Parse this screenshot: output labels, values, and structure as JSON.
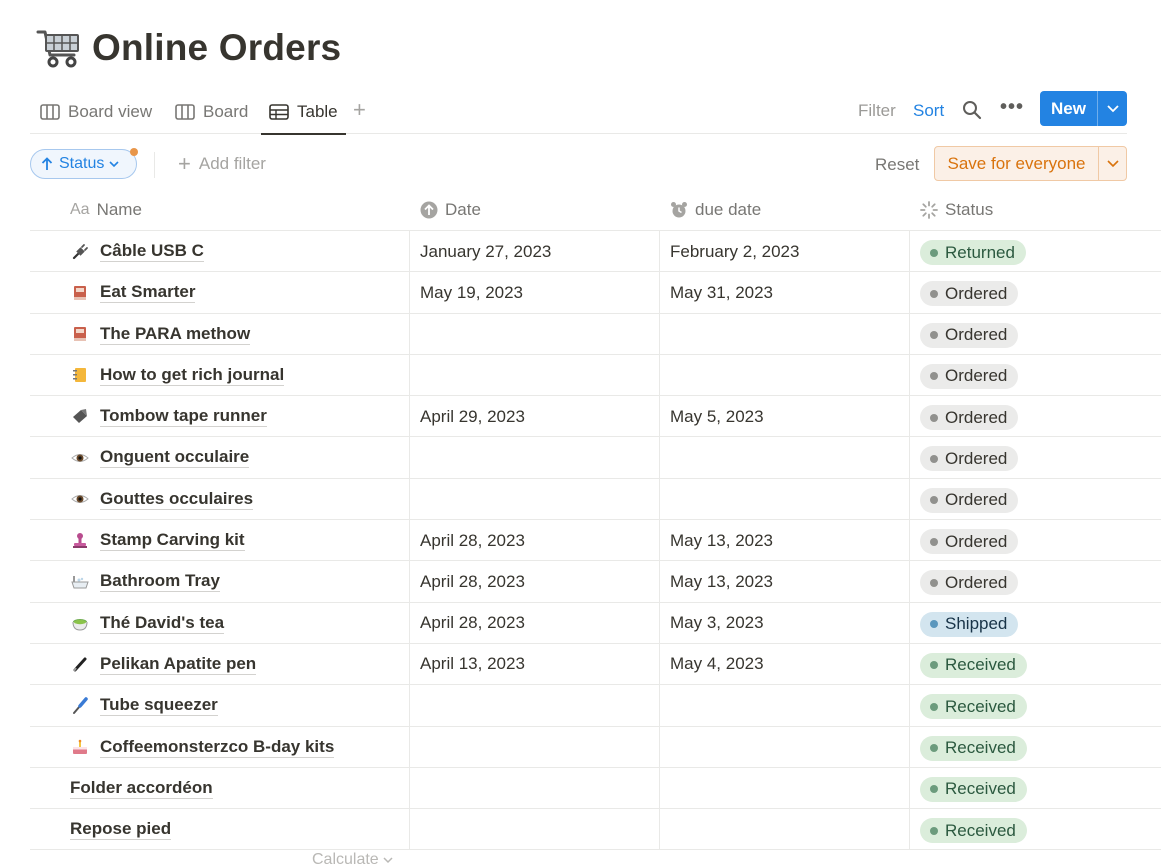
{
  "page": {
    "title": "Online Orders",
    "title_icon": "shopping-cart-icon"
  },
  "views": {
    "tabs": [
      {
        "label": "Board view",
        "icon": "board-icon"
      },
      {
        "label": "Board",
        "icon": "board-icon"
      },
      {
        "label": "Table",
        "icon": "table-icon",
        "active": true
      }
    ],
    "add_view": "+",
    "filter_label": "Filter",
    "sort_label": "Sort",
    "more": "•••",
    "new_label": "New"
  },
  "filters": {
    "status_chip": "Status",
    "add_filter": "Add filter",
    "reset": "Reset",
    "save": "Save for everyone"
  },
  "table": {
    "columns": {
      "name": "Name",
      "name_prefix": "Aa",
      "date": "Date",
      "due": "due date",
      "status": "Status"
    },
    "rows": [
      {
        "icon": "plug-icon",
        "name": "Câble USB C",
        "date": "January 27, 2023",
        "due": "February 2, 2023",
        "status": "Returned"
      },
      {
        "icon": "book-icon",
        "name": "Eat Smarter",
        "date": "May 19, 2023",
        "due": "May 31, 2023",
        "status": "Ordered"
      },
      {
        "icon": "book-icon",
        "name": "The PARA methow",
        "date": "",
        "due": "",
        "status": "Ordered"
      },
      {
        "icon": "notebook-icon",
        "name": "How to get rich journal",
        "date": "",
        "due": "",
        "status": "Ordered"
      },
      {
        "icon": "tape-icon",
        "name": "Tombow tape runner",
        "date": "April 29, 2023",
        "due": "May 5, 2023",
        "status": "Ordered"
      },
      {
        "icon": "eye-icon",
        "name": "Onguent occulaire",
        "date": "",
        "due": "",
        "status": "Ordered"
      },
      {
        "icon": "eye-icon",
        "name": "Gouttes occulaires",
        "date": "",
        "due": "",
        "status": "Ordered"
      },
      {
        "icon": "stamp-icon",
        "name": "Stamp Carving kit",
        "date": "April 28, 2023",
        "due": "May 13, 2023",
        "status": "Ordered"
      },
      {
        "icon": "bathtub-icon",
        "name": "Bathroom Tray",
        "date": "April 28, 2023",
        "due": "May 13, 2023",
        "status": "Ordered"
      },
      {
        "icon": "tea-icon",
        "name": "Thé David's tea",
        "date": "April 28, 2023",
        "due": "May 3, 2023",
        "status": "Shipped"
      },
      {
        "icon": "pen-icon",
        "name": "Pelikan Apatite pen",
        "date": "April 13, 2023",
        "due": "May 4, 2023",
        "status": "Received"
      },
      {
        "icon": "screwdriver-icon",
        "name": "Tube squeezer",
        "date": "",
        "due": "",
        "status": "Received"
      },
      {
        "icon": "cake-icon",
        "name": "Coffeemonsterzco B-day kits",
        "date": "",
        "due": "",
        "status": "Received"
      },
      {
        "icon": "",
        "name": "Folder accordéon",
        "date": "",
        "due": "",
        "status": "Received"
      },
      {
        "icon": "",
        "name": "Repose pied",
        "date": "",
        "due": "",
        "status": "Received"
      }
    ],
    "calculate": "Calculate"
  },
  "colors": {
    "accent": "#2383e2",
    "save_orange": "#d9730d",
    "ordered_bg": "#ebebea",
    "received_bg": "#dbeddb",
    "shipped_bg": "#d3e5ef"
  }
}
